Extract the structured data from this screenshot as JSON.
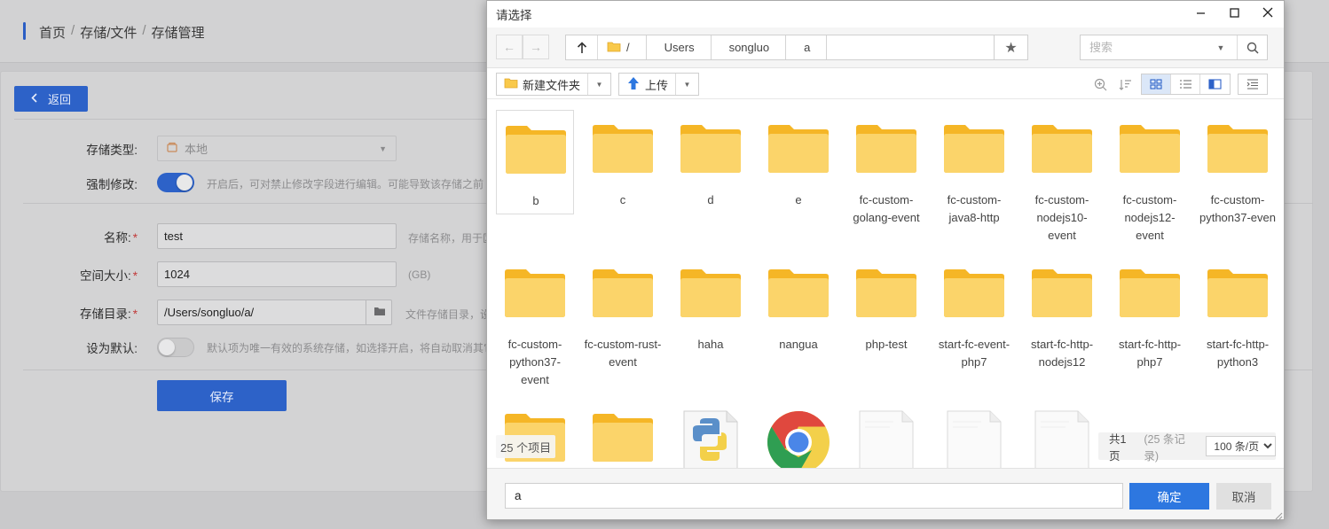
{
  "page": {
    "breadcrumb": [
      "首页",
      "存储/文件",
      "存储管理"
    ],
    "back_label": "返回",
    "form": {
      "storage_type_label": "存储类型:",
      "storage_type_value": "本地",
      "force_modify_label": "强制修改:",
      "force_modify_hint": "开启后，可对禁止修改字段进行编辑。可能导致该存储之前",
      "force_modify_on": true,
      "name_label": "名称:",
      "name_value": "test",
      "name_hint": "存储名称，用于区",
      "size_label": "空间大小:",
      "size_value": "1024",
      "size_hint": "(GB)",
      "dir_label": "存储目录:",
      "dir_value": "/Users/songluo/a/",
      "dir_hint": "文件存储目录，设",
      "default_label": "设为默认:",
      "default_hint": "默认项为唯一有效的系统存储，如选择开启，将自动取消其它",
      "default_on": false,
      "required_mark": "*",
      "save_label": "保存"
    }
  },
  "dialog": {
    "title": "请选择",
    "path": {
      "root": "/",
      "segments": [
        "Users",
        "songluo",
        "a"
      ]
    },
    "search_placeholder": "搜索",
    "toolbar": {
      "new_folder_label": "新建文件夹",
      "upload_label": "上传",
      "active_view": "grid"
    },
    "files": [
      {
        "name": "b",
        "type": "folder",
        "selected": true
      },
      {
        "name": "c",
        "type": "folder"
      },
      {
        "name": "d",
        "type": "folder"
      },
      {
        "name": "e",
        "type": "folder"
      },
      {
        "name": "fc-custom-golang-event",
        "type": "folder"
      },
      {
        "name": "fc-custom-java8-http",
        "type": "folder"
      },
      {
        "name": "fc-custom-nodejs10-event",
        "type": "folder"
      },
      {
        "name": "fc-custom-nodejs12-event",
        "type": "folder"
      },
      {
        "name": "fc-custom-python37-even",
        "type": "folder"
      },
      {
        "name": "fc-custom-python37-event",
        "type": "folder"
      },
      {
        "name": "fc-custom-rust-event",
        "type": "folder"
      },
      {
        "name": "haha",
        "type": "folder"
      },
      {
        "name": "nangua",
        "type": "folder"
      },
      {
        "name": "php-test",
        "type": "folder"
      },
      {
        "name": "start-fc-event-php7",
        "type": "folder"
      },
      {
        "name": "start-fc-http-nodejs12",
        "type": "folder"
      },
      {
        "name": "start-fc-http-php7",
        "type": "folder"
      },
      {
        "name": "start-fc-http-python3",
        "type": "folder"
      },
      {
        "name": "",
        "type": "folder"
      },
      {
        "name": "",
        "type": "folder"
      },
      {
        "name": "",
        "type": "python-file"
      },
      {
        "name": "",
        "type": "chrome-file"
      },
      {
        "name": "",
        "type": "blank-file"
      },
      {
        "name": "",
        "type": "blank-file"
      },
      {
        "name": "",
        "type": "blank-file"
      }
    ],
    "count_text": "25 个项目",
    "pager": {
      "pages_text": "共1页",
      "records_text": "(25 条记录)",
      "page_size": "100 条/页"
    },
    "footer": {
      "input_value": "a",
      "ok_label": "确定",
      "cancel_label": "取消"
    }
  },
  "colors": {
    "primary": "#2d62c8",
    "dialog_primary": "#2d77e0",
    "folder": "#f9c94a",
    "required": "#c13a3a"
  }
}
